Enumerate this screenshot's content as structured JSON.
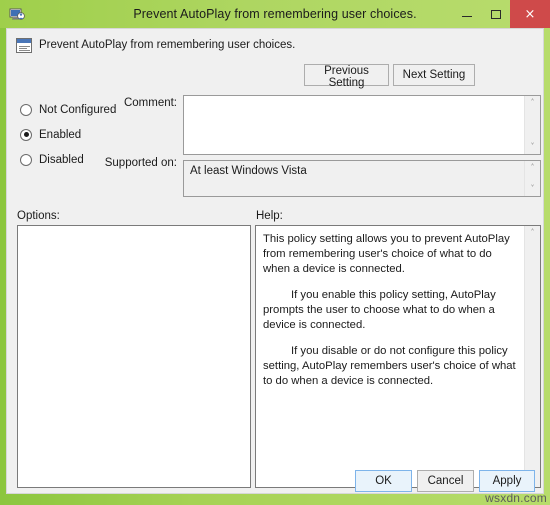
{
  "window": {
    "title": "Prevent AutoPlay from remembering user choices.",
    "icon": "group-policy-icon",
    "controls": {
      "minimize": "–",
      "maximize": "□",
      "close": "×"
    },
    "titlebar_color": "#a6d254",
    "close_color": "#cf4a4a"
  },
  "header": {
    "policy_name": "Prevent AutoPlay from remembering user choices.",
    "policy_icon": "policy-setting-icon",
    "previous_setting_label": "Previous Setting",
    "next_setting_label": "Next Setting"
  },
  "state": {
    "options": [
      {
        "label": "Not Configured",
        "selected": false
      },
      {
        "label": "Enabled",
        "selected": true
      },
      {
        "label": "Disabled",
        "selected": false
      }
    ],
    "selected_value": "Enabled"
  },
  "comment": {
    "label": "Comment:",
    "value": ""
  },
  "supported_on": {
    "label": "Supported on:",
    "value": "At least Windows Vista"
  },
  "panels": {
    "options_label": "Options:",
    "help_label": "Help:",
    "options_items": [],
    "help_paragraphs": [
      {
        "text": "This policy setting allows you to prevent AutoPlay from remembering user's choice of what to do when a device is connected.",
        "indent": false
      },
      {
        "text": "If you enable this policy setting, AutoPlay prompts the user to choose what to do when a device is connected.",
        "indent": true
      },
      {
        "text": "If you disable or do not configure this policy setting, AutoPlay  remembers user's choice of what to do when a device is connected.",
        "indent": true
      }
    ]
  },
  "footer": {
    "ok_label": "OK",
    "cancel_label": "Cancel",
    "apply_label": "Apply"
  },
  "watermark": "wsxdn.com",
  "scroll_arrows": {
    "up": "˄",
    "down": "˅"
  }
}
